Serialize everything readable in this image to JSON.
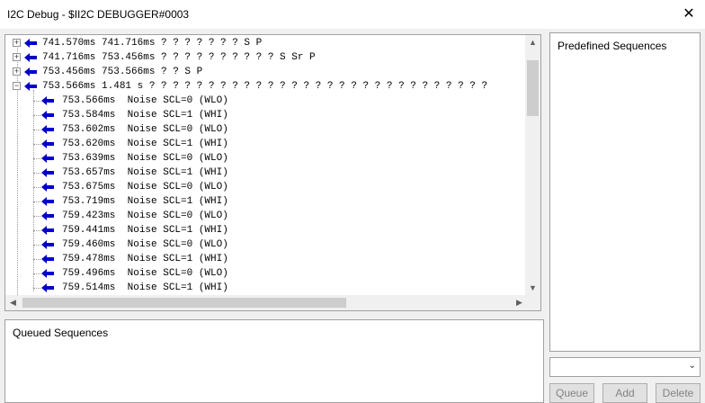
{
  "window": {
    "title": "I2C Debug - $II2C DEBUGGER#0003",
    "close_glyph": "✕"
  },
  "tree": {
    "top_rows": [
      {
        "expander": "+",
        "text": "741.570ms 741.716ms ? ? ? ? ? ? ? S P"
      },
      {
        "expander": "+",
        "text": "741.716ms 753.456ms ? ? ? ? ? ? ? ? ? ? S Sr P"
      },
      {
        "expander": "+",
        "text": "753.456ms 753.566ms ? ? S P"
      },
      {
        "expander": "−",
        "text": "753.566ms  1.481 s ? ? ? ? ? ? ? ? ? ? ? ? ? ? ? ? ? ? ? ? ? ? ? ? ? ? ? ? ?"
      }
    ],
    "child_rows": [
      "753.566ms  Noise SCL=0 (WLO)",
      "753.584ms  Noise SCL=1 (WHI)",
      "753.602ms  Noise SCL=0 (WLO)",
      "753.620ms  Noise SCL=1 (WHI)",
      "753.639ms  Noise SCL=0 (WLO)",
      "753.657ms  Noise SCL=1 (WHI)",
      "753.675ms  Noise SCL=0 (WLO)",
      "753.719ms  Noise SCL=1 (WHI)",
      "759.423ms  Noise SCL=0 (WLO)",
      "759.441ms  Noise SCL=1 (WHI)",
      "759.460ms  Noise SCL=0 (WLO)",
      "759.478ms  Noise SCL=1 (WHI)",
      "759.496ms  Noise SCL=0 (WLO)",
      "759.514ms  Noise SCL=1 (WHI)"
    ],
    "arrow_color": "#0000c8",
    "icons": {
      "row": "left-arrow-icon",
      "expand": "plus-icon",
      "collapse": "minus-icon"
    }
  },
  "predefined": {
    "label": "Predefined Sequences"
  },
  "queued": {
    "label": "Queued Sequences"
  },
  "buttons": {
    "queue": "Queue",
    "add": "Add",
    "delete": "Delete"
  }
}
